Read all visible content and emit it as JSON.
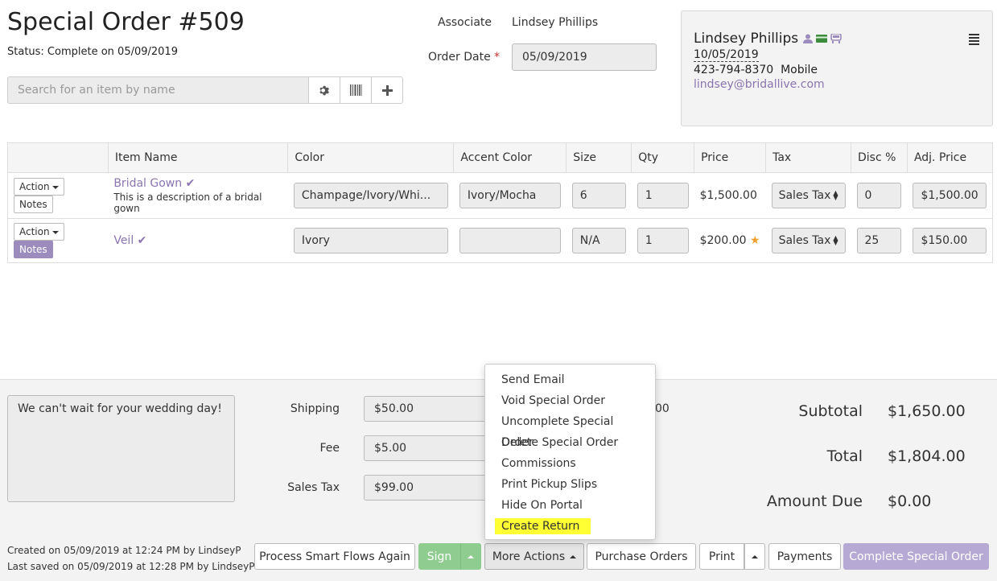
{
  "header": {
    "title": "Special Order #509",
    "status": "Status: Complete on 05/09/2019",
    "associate_label": "Associate",
    "associate_value": "Lindsey Phillips",
    "order_date_label": "Order Date",
    "order_date_required": "*",
    "order_date_value": "05/09/2019"
  },
  "search": {
    "placeholder": "Search for an item by name",
    "buttons": [
      "gear-icon",
      "barcode-icon",
      "plus-icon"
    ]
  },
  "customer": {
    "name": "Lindsey Phillips",
    "dob": "10/05/2019",
    "phone": "423-794-8370",
    "phone_type": "Mobile",
    "email": "lindsey@bridallive.com",
    "icons": [
      "person-icon",
      "card-icon",
      "car-icon"
    ]
  },
  "table": {
    "headers": [
      "",
      "Item Name",
      "Color",
      "Accent Color",
      "Size",
      "Qty",
      "Price",
      "Tax",
      "Disc %",
      "Adj. Price"
    ],
    "action_label": "Action",
    "notes_label": "Notes",
    "rows": [
      {
        "name": "Bridal Gown",
        "description": "This is a description of a bridal gown",
        "color": "Champage/Ivory/Whi...",
        "accent": "Ivory/Mocha",
        "size": "6",
        "qty": "1",
        "price": "$1,500.00",
        "tax": "Sales Tax",
        "disc": "0",
        "adj_price": "$1,500.00",
        "notes_active": false,
        "star": false
      },
      {
        "name": "Veil",
        "description": "",
        "color": "Ivory",
        "accent": "",
        "size": "N/A",
        "qty": "1",
        "price": "$200.00",
        "tax": "Sales Tax",
        "disc": "25",
        "adj_price": "$150.00",
        "notes_active": true,
        "star": true
      }
    ]
  },
  "footer": {
    "notes": "We can't wait for your wedding day!",
    "shipping_label": "Shipping",
    "shipping_value": "$50.00",
    "fee_label": "Fee",
    "fee_value": "$5.00",
    "sales_tax_label": "Sales Tax",
    "sales_tax_value": "$99.00",
    "partial_value": "00",
    "subtotal_label": "Subtotal",
    "subtotal_value": "$1,650.00",
    "total_label": "Total",
    "total_value": "$1,804.00",
    "amount_due_label": "Amount Due",
    "amount_due_value": "$0.00",
    "created": "Created on 05/09/2019 at 12:24 PM by LindseyP",
    "saved": "Last saved on 05/09/2019 at 12:28 PM by LindseyP"
  },
  "buttons": {
    "smart_flows": "Process Smart Flows Again",
    "sign": "Sign",
    "more_actions": "More Actions",
    "purchase_orders": "Purchase Orders",
    "print": "Print",
    "payments": "Payments",
    "complete": "Complete Special Order"
  },
  "dropdown": {
    "items": [
      "Send Email",
      "Void Special Order",
      "Uncomplete Special Order",
      "Delete Special Order",
      "Commissions",
      "Print Pickup Slips",
      "Hide On Portal",
      "Create Return"
    ],
    "highlighted": "Create Return"
  },
  "colors": {
    "accent_purple": "#8a74b0",
    "notes_active": "#9b8cbd",
    "sign_green": "#8fcc8f",
    "complete_purple": "#b6aad4",
    "highlight_yellow": "#ffff33",
    "star": "#f0a030"
  }
}
